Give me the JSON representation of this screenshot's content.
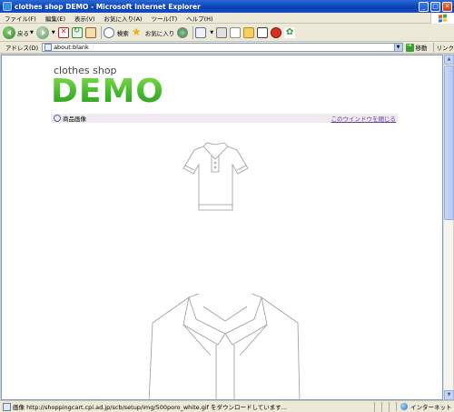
{
  "window": {
    "title": "clothes shop DEMO - Microsoft Internet Explorer"
  },
  "menu": [
    "ファイル(F)",
    "編集(E)",
    "表示(V)",
    "お気に入り(A)",
    "ツール(T)",
    "ヘルプ(H)"
  ],
  "toolbar": {
    "back_label": "戻る",
    "search_label": "検索",
    "favorites_label": "お気に入り"
  },
  "address": {
    "label": "アドレス(D)",
    "value": "about:blank",
    "go_label": "移動",
    "links_label": "リンク"
  },
  "page": {
    "logo_small": "clothes shop",
    "logo_big": "DEMO",
    "section_title": "商品画像",
    "close_link": "このウインドウを閉じる"
  },
  "status": {
    "text": "画像 http://shoppingcart.cpi.ad.jp/scb/setup/img/500poro_white.gif をダウンロードしています...",
    "zone": "インターネット"
  }
}
